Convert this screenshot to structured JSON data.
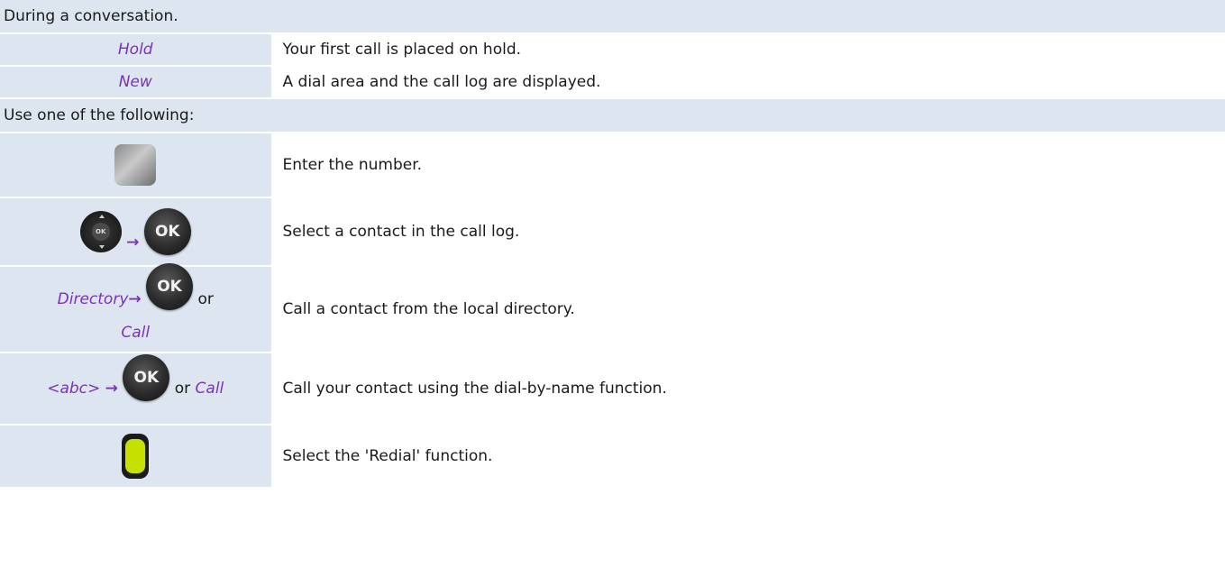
{
  "rows": [
    {
      "type": "header",
      "text": "During a conversation."
    },
    {
      "type": "step",
      "left_soft": "Hold",
      "desc": "Your first call is placed on hold."
    },
    {
      "type": "step",
      "left_soft": "New",
      "desc": "A dial area and the call log are displayed."
    },
    {
      "type": "header",
      "text": "Use one of the following:"
    },
    {
      "type": "step",
      "icon": "keypad-icon",
      "desc": "Enter the number."
    },
    {
      "type": "step",
      "icon": "navigator-icon",
      "arrow": "→",
      "ok": "OK",
      "desc": "Select a contact in the call log."
    },
    {
      "type": "step",
      "left_soft": "Directory",
      "arrow": "→",
      "ok": "OK",
      "or": "or",
      "left_soft2": "Call",
      "desc": "Call a contact from the local directory."
    },
    {
      "type": "step",
      "left_soft": "<abc>",
      "arrow": "→",
      "ok": "OK",
      "or": "or",
      "left_soft2": "Call",
      "desc": "Call your contact using the dial-by-name function."
    },
    {
      "type": "step",
      "icon": "redial-key-icon",
      "desc": "Select the 'Redial' function."
    }
  ]
}
